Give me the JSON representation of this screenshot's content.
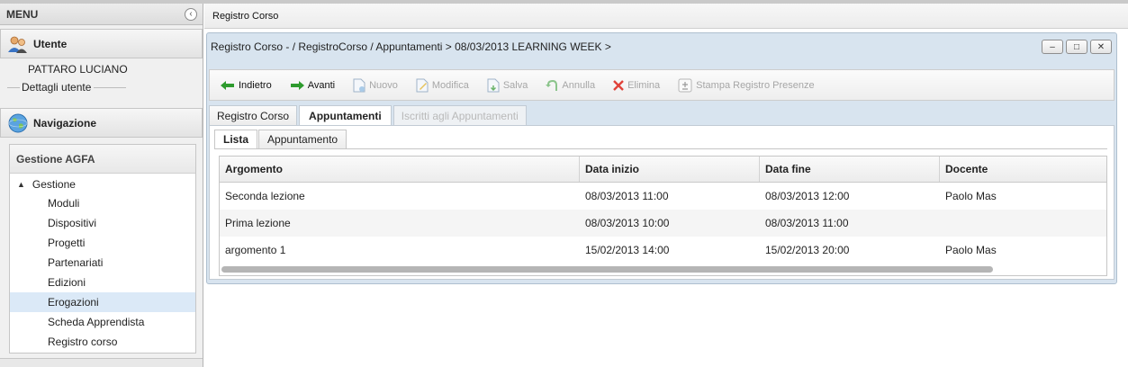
{
  "menu": {
    "title": "MENU",
    "collapse_glyph": "‹"
  },
  "user_section": {
    "title": "Utente",
    "icon": "users-icon",
    "user_name": "PATTARO LUCIANO",
    "details_label": "Dettagli utente"
  },
  "nav_section": {
    "title": "Navigazione",
    "icon": "globe-icon",
    "panel_title": "Gestione AGFA",
    "tree_root": "Gestione",
    "items": [
      {
        "label": "Moduli"
      },
      {
        "label": "Dispositivi"
      },
      {
        "label": "Progetti"
      },
      {
        "label": "Partenariati"
      },
      {
        "label": "Edizioni"
      },
      {
        "label": "Erogazioni",
        "selected": true
      },
      {
        "label": "Scheda Apprendista"
      },
      {
        "label": "Registro corso"
      }
    ]
  },
  "main": {
    "tab_label": "Registro Corso"
  },
  "window": {
    "title": "Registro Corso - / RegistroCorso / Appuntamenti > 08/03/2013 LEARNING WEEK >",
    "controls": {
      "minimize": "–",
      "maximize": "□",
      "close": "✕"
    }
  },
  "toolbar": {
    "back": "Indietro",
    "forward": "Avanti",
    "new": "Nuovo",
    "edit": "Modifica",
    "save": "Salva",
    "cancel": "Annulla",
    "delete": "Elimina",
    "print": "Stampa Registro Presenze"
  },
  "tabs": [
    {
      "label": "Registro Corso",
      "state": "normal"
    },
    {
      "label": "Appuntamenti",
      "state": "active"
    },
    {
      "label": "Iscritti agli Appuntamenti",
      "state": "disabled"
    }
  ],
  "subtabs": [
    {
      "label": "Lista",
      "state": "active"
    },
    {
      "label": "Appuntamento",
      "state": "normal"
    }
  ],
  "grid": {
    "columns": [
      "Argomento",
      "Data inizio",
      "Data fine",
      "Docente"
    ],
    "rows": [
      [
        "Seconda lezione",
        "08/03/2013 11:00",
        "08/03/2013 12:00",
        "Paolo Mas"
      ],
      [
        "Prima lezione",
        "08/03/2013 10:00",
        "08/03/2013 11:00",
        ""
      ],
      [
        "argomento 1",
        "15/02/2013 14:00",
        "15/02/2013 20:00",
        "Paolo Mas"
      ]
    ]
  },
  "colors": {
    "window_bg": "#d8e4ef",
    "selected_item": "#dbe9f7",
    "back_arrow": "#2e9b2e",
    "delete_x": "#e0423a"
  }
}
